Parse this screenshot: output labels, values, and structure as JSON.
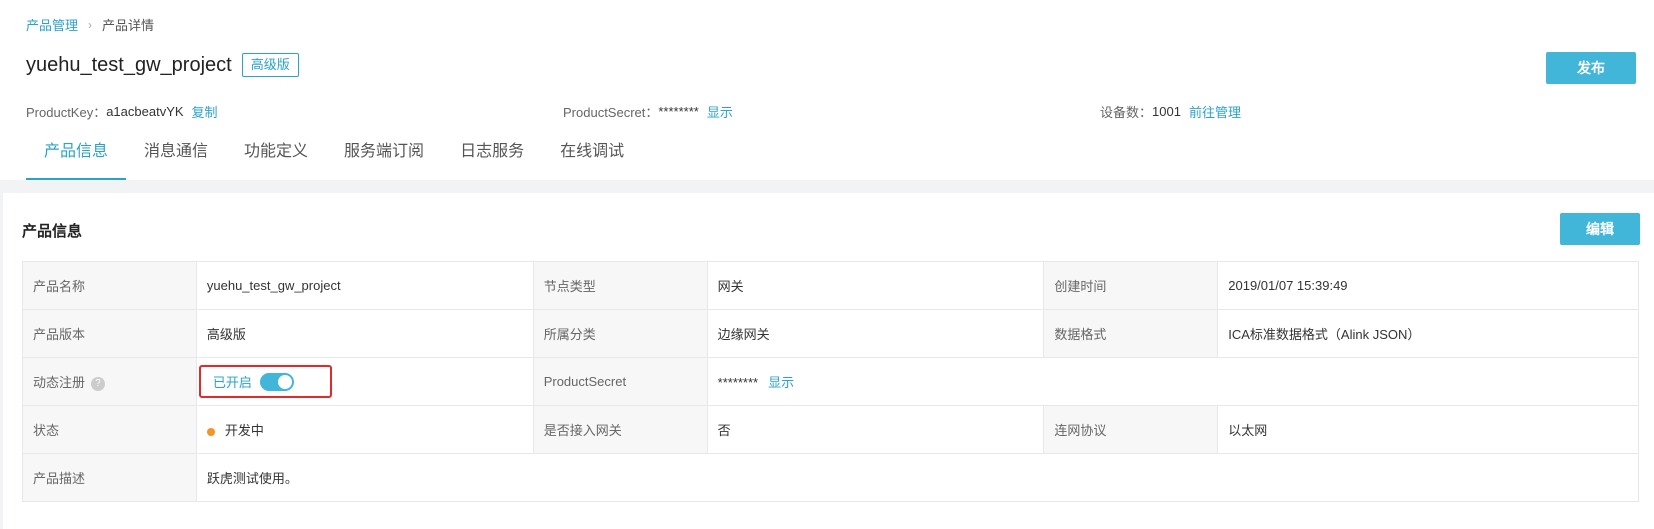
{
  "breadcrumb": {
    "parent": "产品管理",
    "separator": "›",
    "current": "产品详情"
  },
  "product": {
    "name": "yuehu_test_gw_project",
    "edition_badge": "高级版"
  },
  "publish_label": "发布",
  "meta": {
    "product_key_label": "ProductKey：",
    "product_key_value": "a1acbeatvYK",
    "copy_label": "复制",
    "product_secret_label": "ProductSecret：",
    "product_secret_value": "********",
    "show_label": "显示",
    "device_count_label": "设备数：",
    "device_count_value": "1001",
    "manage_label": "前往管理"
  },
  "tabs": [
    "产品信息",
    "消息通信",
    "功能定义",
    "服务端订阅",
    "日志服务",
    "在线调试"
  ],
  "section": {
    "title": "产品信息",
    "edit_label": "编辑"
  },
  "info": {
    "name_label": "产品名称",
    "name_value": "yuehu_test_gw_project",
    "node_type_label": "节点类型",
    "node_type_value": "网关",
    "created_label": "创建时间",
    "created_value": "2019/01/07 15:39:49",
    "version_label": "产品版本",
    "version_value": "高级版",
    "category_label": "所属分类",
    "category_value": "边缘网关",
    "data_format_label": "数据格式",
    "data_format_value": "ICA标准数据格式（Alink JSON）",
    "dyn_reg_label": "动态注册",
    "dyn_reg_help": "?",
    "dyn_reg_value": "已开启",
    "secret_label": "ProductSecret",
    "secret_value": "********",
    "secret_show": "显示",
    "status_label": "状态",
    "status_value": "开发中",
    "gateway_access_label": "是否接入网关",
    "gateway_access_value": "否",
    "network_label": "连网协议",
    "network_value": "以太网",
    "desc_label": "产品描述",
    "desc_value": "跃虎测试使用。"
  },
  "colors": {
    "accent": "#2aa3c9",
    "button": "#41b6d9",
    "status_dot": "#f39423",
    "highlight_box": "#e12b2b"
  }
}
